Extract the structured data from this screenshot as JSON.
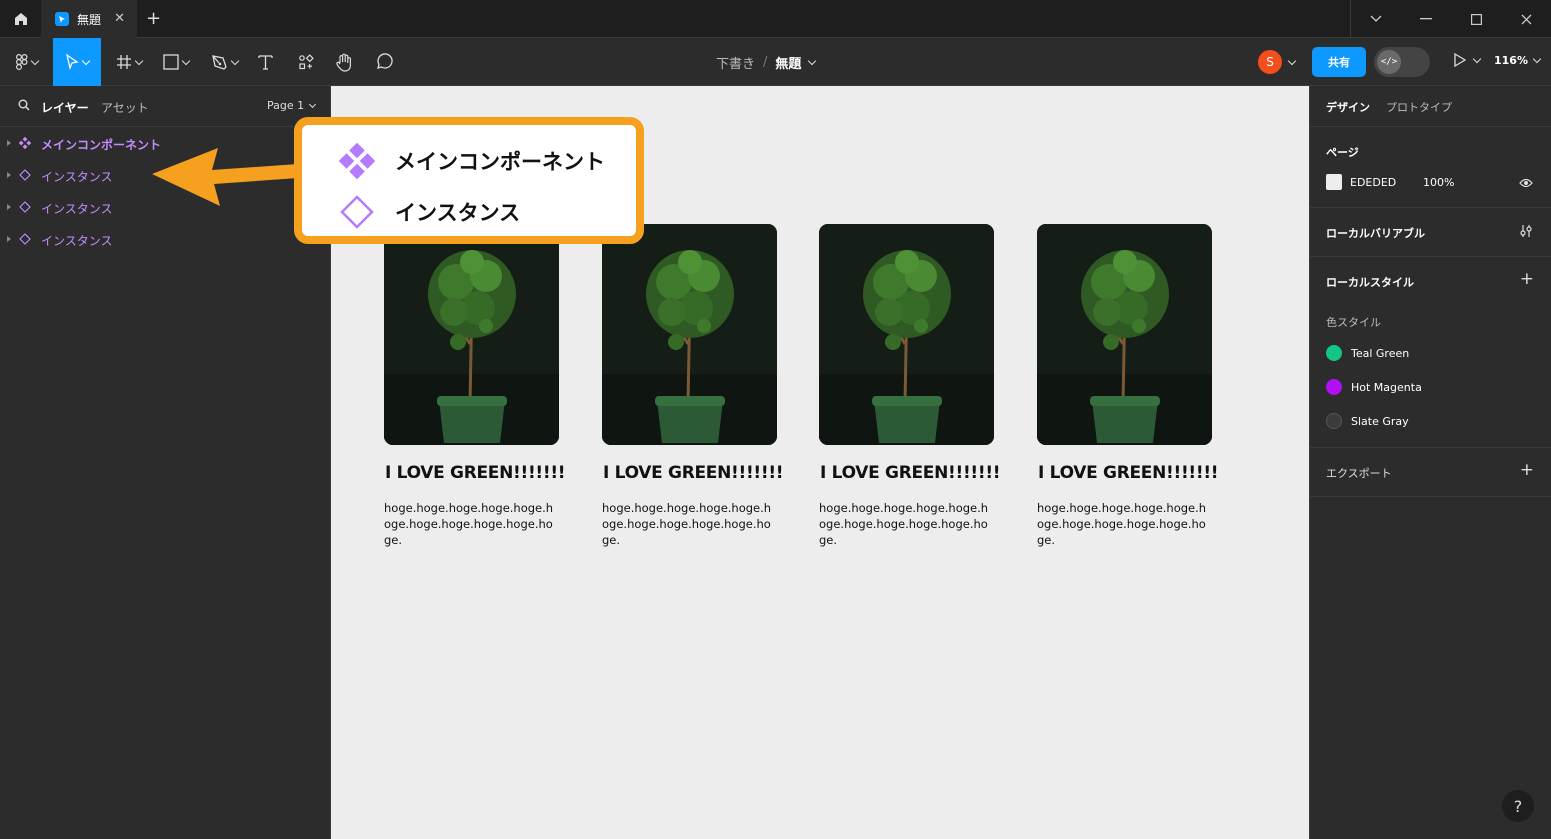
{
  "titlebar": {
    "tab_title": "無題",
    "tab_close": "✕",
    "tab_add": "+"
  },
  "toolbar": {
    "breadcrumb_project": "下書き",
    "breadcrumb_sep": "/",
    "breadcrumb_file": "無題",
    "avatar_initial": "S",
    "share_label": "共有",
    "dev_mode_label": "</>",
    "zoom": "116%"
  },
  "left_panel": {
    "tab_layers": "レイヤー",
    "tab_assets": "アセット",
    "page_selector": "Page 1",
    "layers": [
      {
        "label": "メインコンポーネント",
        "kind": "main-component"
      },
      {
        "label": "インスタンス",
        "kind": "instance"
      },
      {
        "label": "インスタンス",
        "kind": "instance"
      },
      {
        "label": "インスタンス",
        "kind": "instance"
      }
    ]
  },
  "canvas": {
    "cards": [
      {
        "title": "I LOVE GREEN!!!!!!!",
        "body": "hoge.hoge.hoge.hoge.hoge.hoge.hoge.hoge.hoge.hoge.hoge."
      },
      {
        "title": "I LOVE GREEN!!!!!!!",
        "body": "hoge.hoge.hoge.hoge.hoge.hoge.hoge.hoge.hoge.hoge.hoge."
      },
      {
        "title": "I LOVE GREEN!!!!!!!",
        "body": "hoge.hoge.hoge.hoge.hoge.hoge.hoge.hoge.hoge.hoge.hoge."
      },
      {
        "title": "I LOVE GREEN!!!!!!!",
        "body": "hoge.hoge.hoge.hoge.hoge.hoge.hoge.hoge.hoge.hoge.hoge."
      }
    ],
    "background_color": "#EDEDED"
  },
  "callout": {
    "main_component_label": "メインコンポーネント",
    "instance_label": "インスタンス",
    "accent_color": "#f5a01f",
    "component_color": "#b57bff"
  },
  "right_panel": {
    "tab_design": "デザイン",
    "tab_prototype": "プロトタイプ",
    "page_section_title": "ページ",
    "page_color_hex": "EDEDED",
    "page_opacity": "100%",
    "local_variables_title": "ローカルバリアブル",
    "local_styles_title": "ローカルスタイル",
    "color_styles_title": "色スタイル",
    "color_styles": [
      {
        "name": "Teal Green",
        "color": "#14c585"
      },
      {
        "name": "Hot Magenta",
        "color": "#b10ff5"
      },
      {
        "name": "Slate Gray",
        "color": "#3b3b3b"
      }
    ],
    "export_title": "エクスポート",
    "add_symbol": "+"
  },
  "help_label": "?"
}
